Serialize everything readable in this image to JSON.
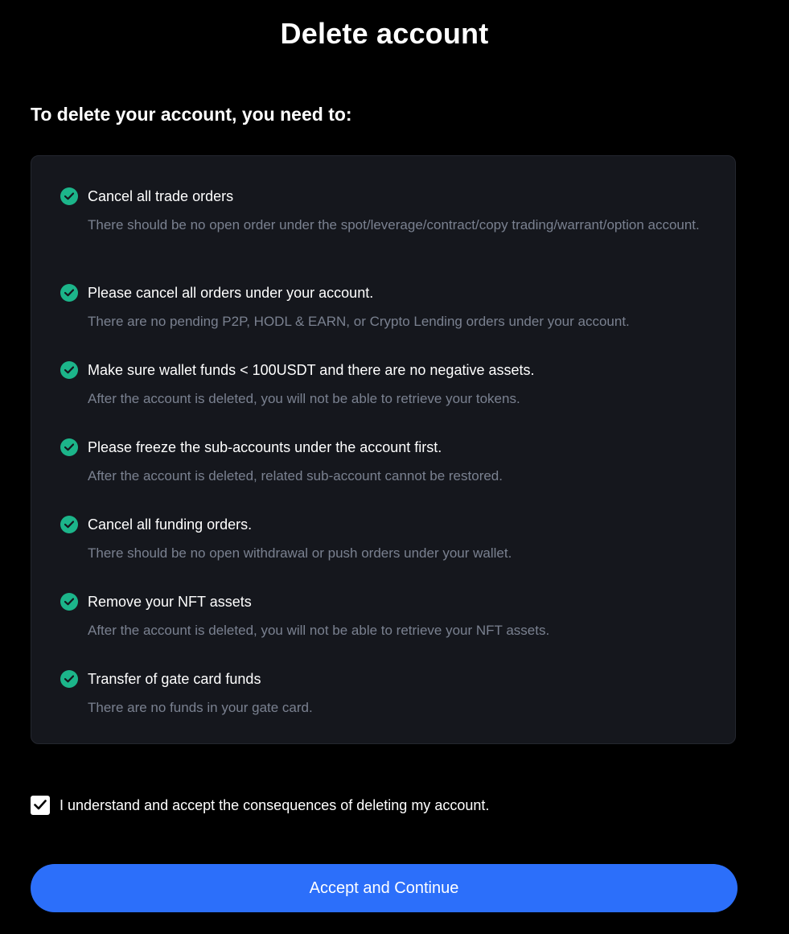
{
  "page": {
    "title": "Delete account",
    "heading": "To delete your account, you need to:"
  },
  "requirements": [
    {
      "title": "Cancel all trade orders",
      "description": "There should be no open order under the spot/leverage/contract/copy trading/warrant/option account.",
      "status_icon": "check-circle-icon"
    },
    {
      "title": "Please cancel all orders under your account.",
      "description": "There are no pending P2P, HODL & EARN, or Crypto Lending orders under your account.",
      "status_icon": "check-circle-icon"
    },
    {
      "title": "Make sure wallet funds < 100USDT and there are no negative assets.",
      "description": "After the account is deleted, you will not be able to retrieve your tokens.",
      "status_icon": "check-circle-icon"
    },
    {
      "title": "Please freeze the sub-accounts under the account first.",
      "description": "After the account is deleted, related sub-account cannot be restored.",
      "status_icon": "check-circle-icon"
    },
    {
      "title": "Cancel all funding orders.",
      "description": "There should be no open withdrawal or push orders under your wallet.",
      "status_icon": "check-circle-icon"
    },
    {
      "title": "Remove your NFT assets",
      "description": "After the account is deleted, you will not be able to retrieve your NFT assets.",
      "status_icon": "check-circle-icon"
    },
    {
      "title": "Transfer of gate card funds",
      "description": "There are no funds in your gate card.",
      "status_icon": "check-circle-icon"
    }
  ],
  "consent": {
    "label": "I understand and accept the consequences of deleting my account.",
    "checked": true
  },
  "actions": {
    "accept_label": "Accept and Continue"
  },
  "colors": {
    "background": "#000000",
    "card_background": "#15171d",
    "check_green": "#1cb58a",
    "primary_button": "#2c6ffa",
    "muted_text": "#7a8190"
  }
}
